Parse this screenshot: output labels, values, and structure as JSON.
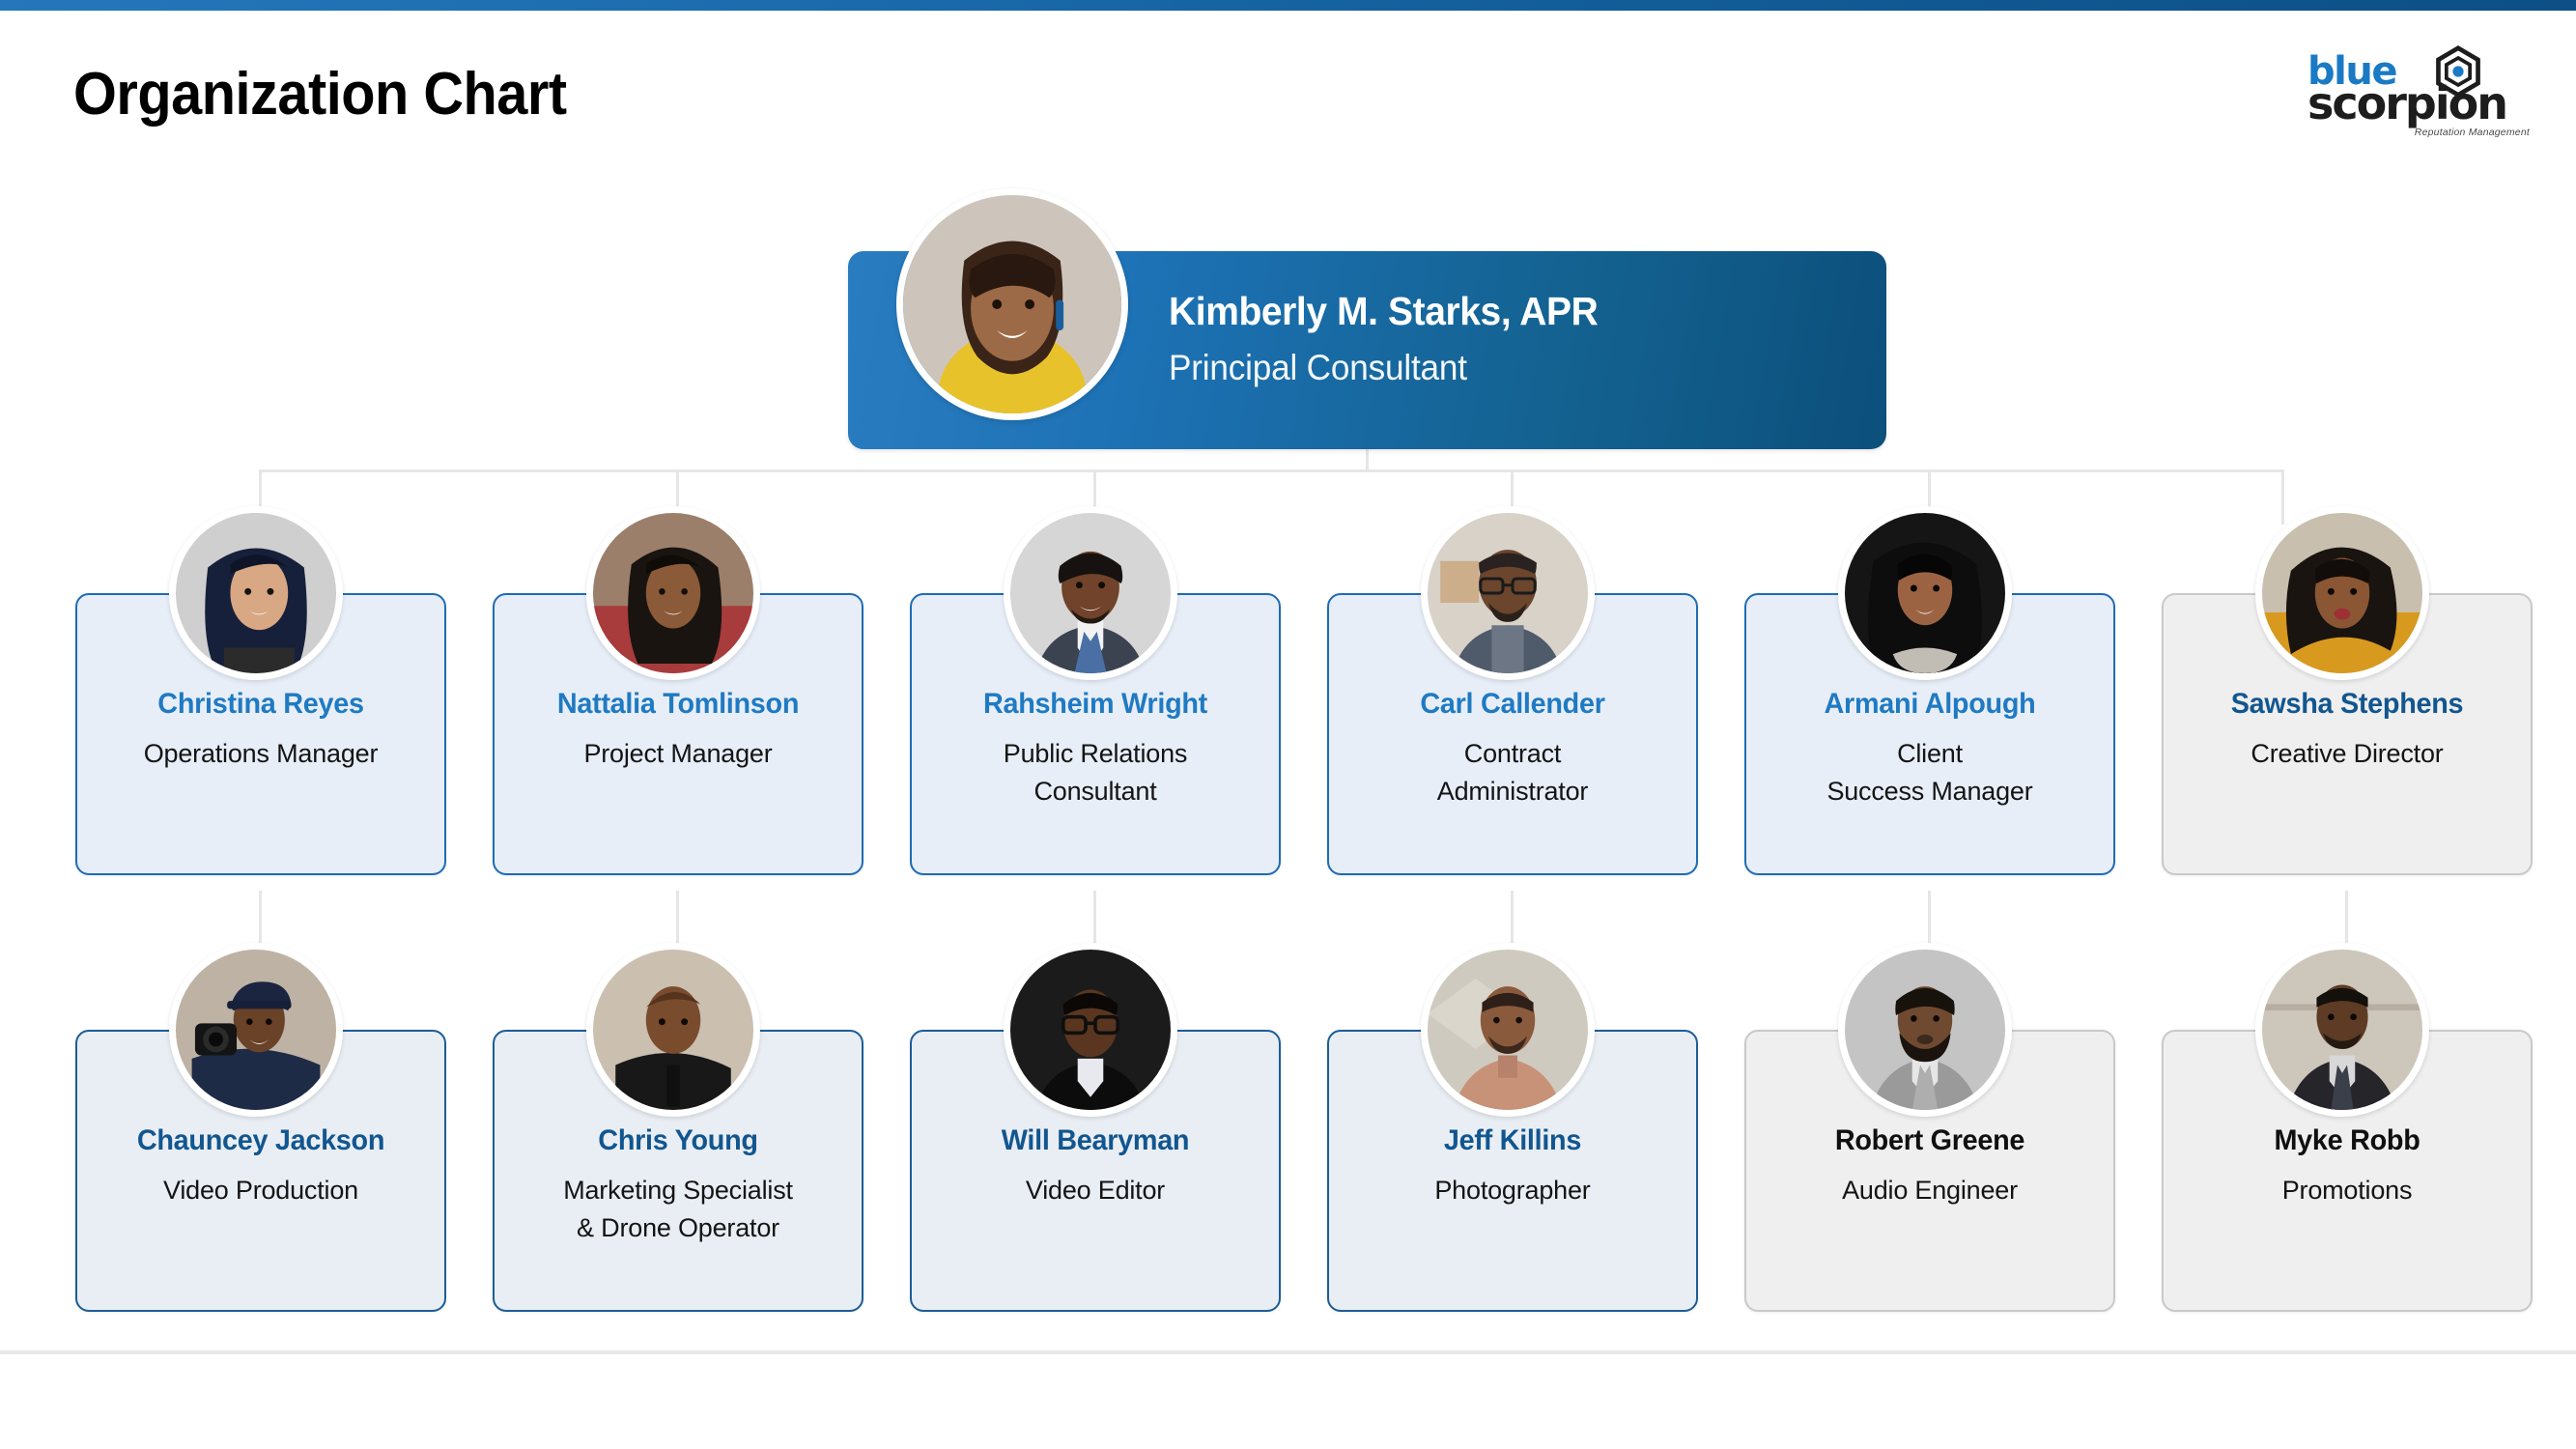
{
  "header": {
    "title": "Organization Chart",
    "logo": {
      "word_blue": "blue",
      "word_dark": "scorpion",
      "tagline": "Reputation Management"
    }
  },
  "colors": {
    "accent_blue": "#1f7ac2",
    "navy": "#12568f",
    "card_fill_blue": "#e7eef8",
    "card_fill_gray": "#efefef",
    "card_border_blue": "#1f6cb5",
    "card_border_gray": "#c9c9c9",
    "connector_gray": "#e6e6e6",
    "root_gradient_from": "#2a7cc0",
    "root_gradient_to": "#0c4f7c",
    "topbar_from": "#2477bb",
    "topbar_to": "#0d4f86"
  },
  "root": {
    "name": "Kimberly M. Starks, APR",
    "role": "Principal Consultant",
    "avatar_alt": "portrait-kimberly-starks"
  },
  "row1": [
    {
      "name": "Christina Reyes",
      "role_line1": "Operations Manager",
      "role_line2": "",
      "style": "blue",
      "avatar_alt": "portrait-christina-reyes"
    },
    {
      "name": "Nattalia Tomlinson",
      "role_line1": "Project Manager",
      "role_line2": "",
      "style": "blue",
      "avatar_alt": "portrait-nattalia-tomlinson"
    },
    {
      "name": "Rahsheim Wright",
      "role_line1": "Public Relations",
      "role_line2": "Consultant",
      "style": "blue",
      "avatar_alt": "portrait-rahsheim-wright"
    },
    {
      "name": "Carl Callender",
      "role_line1": "Contract",
      "role_line2": "Administrator",
      "style": "blue",
      "avatar_alt": "portrait-carl-callender"
    },
    {
      "name": "Armani Alpough",
      "role_line1": "Client",
      "role_line2": "Success Manager",
      "style": "blue",
      "avatar_alt": "portrait-armani-alpough"
    },
    {
      "name": "Sawsha Stephens",
      "role_line1": "Creative Director",
      "role_line2": "",
      "style": "gray-navy",
      "avatar_alt": "portrait-sawsha-stephens"
    }
  ],
  "row2": [
    {
      "name": "Chauncey Jackson",
      "role_line1": "Video Production",
      "role_line2": "",
      "style": "navy",
      "avatar_alt": "portrait-chauncey-jackson"
    },
    {
      "name": "Chris Young",
      "role_line1": "Marketing Specialist",
      "role_line2": "& Drone Operator",
      "style": "navy",
      "avatar_alt": "portrait-chris-young"
    },
    {
      "name": "Will Bearyman",
      "role_line1": "Video Editor",
      "role_line2": "",
      "style": "navy",
      "avatar_alt": "portrait-will-bearyman"
    },
    {
      "name": "Jeff Killins",
      "role_line1": "Photographer",
      "role_line2": "",
      "style": "navy",
      "avatar_alt": "portrait-jeff-killins"
    },
    {
      "name": "Robert Greene",
      "role_line1": "Audio Engineer",
      "role_line2": "",
      "style": "gray",
      "avatar_alt": "portrait-robert-greene"
    },
    {
      "name": "Myke Robb",
      "role_line1": "Promotions",
      "role_line2": "",
      "style": "gray",
      "avatar_alt": "portrait-myke-robb"
    }
  ]
}
